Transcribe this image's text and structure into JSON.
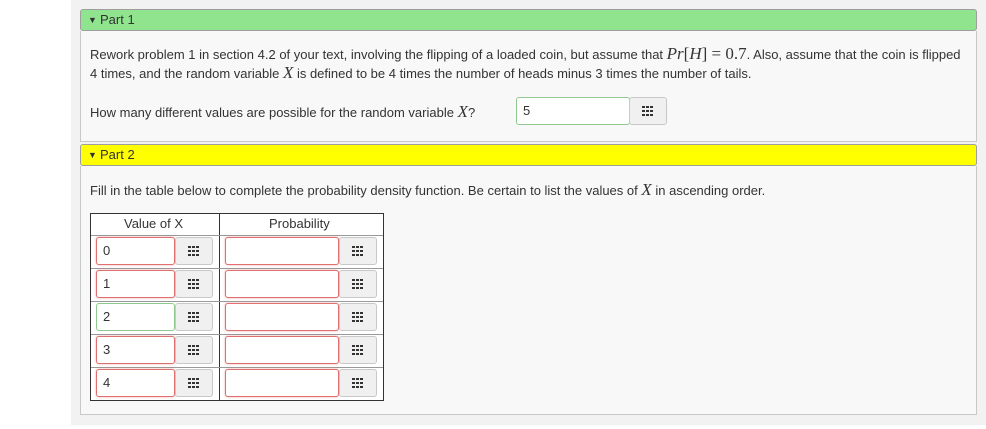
{
  "part1": {
    "title": "Part 1",
    "text_a": "Rework problem 1 in section 4.2 of your text, involving the flipping of a loaded coin, but assume that ",
    "math_pr": "Pr",
    "math_open": "[",
    "math_h": "H",
    "math_close": "]",
    "math_eq": " = 0.7",
    "text_b": ". Also, assume that the coin is flipped 4 times, and the random variable ",
    "math_x": "X",
    "text_c": " is defined to be 4 times the number of heads minus 3 times the number of tails.",
    "question_a": "How many different values are possible for the random variable ",
    "question_x": "X",
    "question_b": "?",
    "answer": "5"
  },
  "part2": {
    "title": "Part 2",
    "instruction_a": "Fill in the table below to complete the probability density function. Be certain to list the values of ",
    "instruction_x": "X",
    "instruction_b": " in ascending order.",
    "col_value": "Value of X",
    "col_prob": "Probability",
    "rows": [
      {
        "value": "0",
        "prob": ""
      },
      {
        "value": "1",
        "prob": ""
      },
      {
        "value": "2",
        "prob": ""
      },
      {
        "value": "3",
        "prob": ""
      },
      {
        "value": "4",
        "prob": ""
      }
    ]
  },
  "icons": {
    "collapse": "triangle-down-icon",
    "keypad": "keypad-grid-icon"
  },
  "colors": {
    "part1_header": "#8fe48d",
    "part2_header": "#ffff00",
    "error_border": "#e07070",
    "ok_border": "#8fc98f"
  }
}
